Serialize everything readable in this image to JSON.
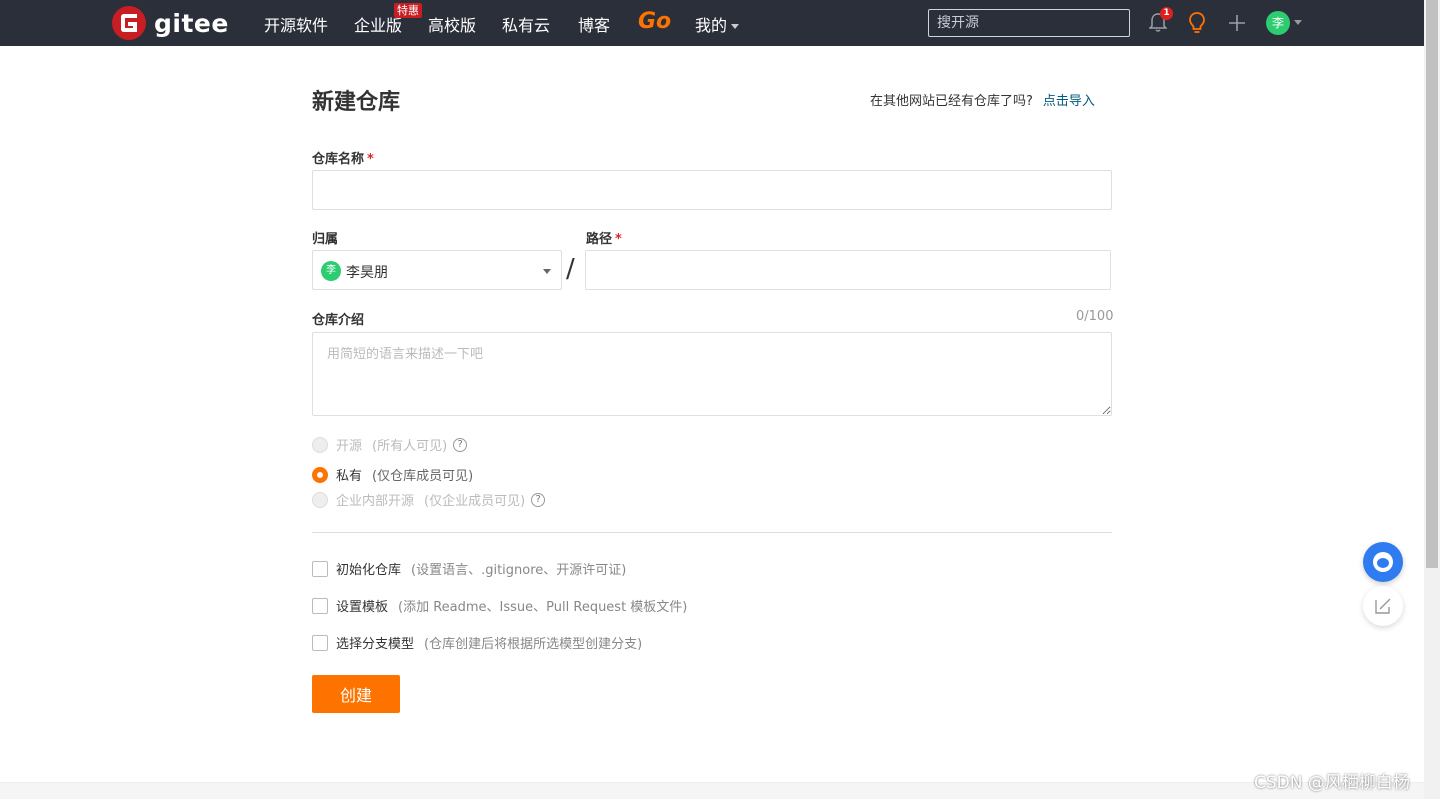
{
  "nav": {
    "logo_text": "gitee",
    "items": [
      "开源软件",
      "企业版",
      "高校版",
      "私有云",
      "博客"
    ],
    "hot_badge": "特惠",
    "go_label": "Go",
    "mine_label": "我的",
    "search_placeholder": "搜开源",
    "notification_count": "1",
    "avatar_initial": "李"
  },
  "form": {
    "title": "新建仓库",
    "import_hint": "在其他网站已经有仓库了吗?",
    "import_link": "点击导入",
    "repo_name_label": "仓库名称",
    "required_mark": "*",
    "owner_label": "归属",
    "owner_name": "李昊朋",
    "owner_initial": "李",
    "path_label": "路径",
    "slash": "/",
    "desc_label": "仓库介绍",
    "desc_counter": "0/100",
    "desc_placeholder": "用简短的语言来描述一下吧",
    "visibility": [
      {
        "label": "开源",
        "desc": "(所有人可见)",
        "checked": false,
        "disabled": true,
        "help": true
      },
      {
        "label": "私有",
        "desc": "(仅仓库成员可见)",
        "checked": true,
        "disabled": false,
        "help": false
      },
      {
        "label": "企业内部开源",
        "desc": "(仅企业成员可见)",
        "checked": false,
        "disabled": true,
        "help": true
      }
    ],
    "options": [
      {
        "label": "初始化仓库",
        "desc": "(设置语言、.gitignore、开源许可证)"
      },
      {
        "label": "设置模板",
        "desc": "(添加 Readme、Issue、Pull Request 模板文件)"
      },
      {
        "label": "选择分支模型",
        "desc": "(仓库创建后将根据所选模型创建分支)"
      }
    ],
    "submit_label": "创建"
  },
  "watermark": "CSDN @风栖柳白杨",
  "colors": {
    "nav_bg": "#2b2f3a",
    "accent": "#fe7300",
    "brand": "#c71d23",
    "link": "#005980"
  }
}
